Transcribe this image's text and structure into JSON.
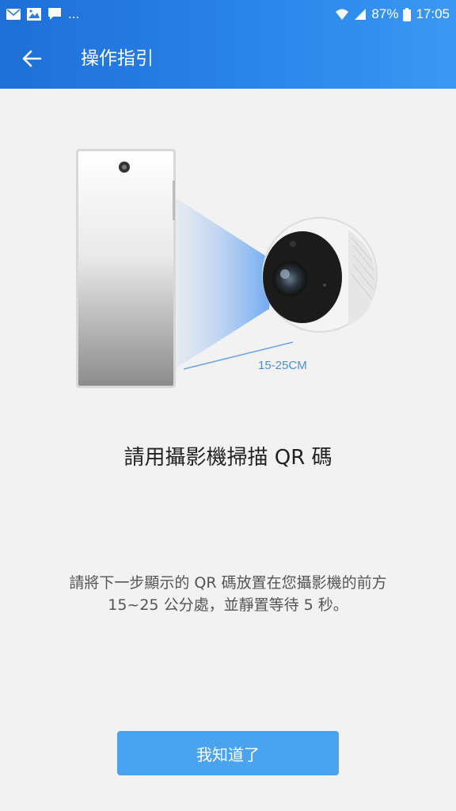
{
  "status_bar": {
    "left_icons": [
      "mail-icon",
      "image-icon",
      "chat-icon",
      "more-notifications-icon"
    ],
    "more_text": "...",
    "battery_percent": "87%",
    "time": "17:05"
  },
  "app_bar": {
    "title": "操作指引",
    "back_icon": "arrow-left-icon"
  },
  "illustration": {
    "distance_label": "15-25CM"
  },
  "main": {
    "headline": "請用攝影機掃描 QR 碼",
    "description_line1": "請將下一步顯示的 QR 碼放置在您攝影機的前方",
    "description_line2": "15~25 公分處，並靜置等待 5 秒。",
    "confirm_button": "我知道了"
  },
  "colors": {
    "app_bar": "#2a84ea",
    "button": "#4aa3ef",
    "background": "#f2f2f2",
    "distance_label": "#4a90d9"
  }
}
